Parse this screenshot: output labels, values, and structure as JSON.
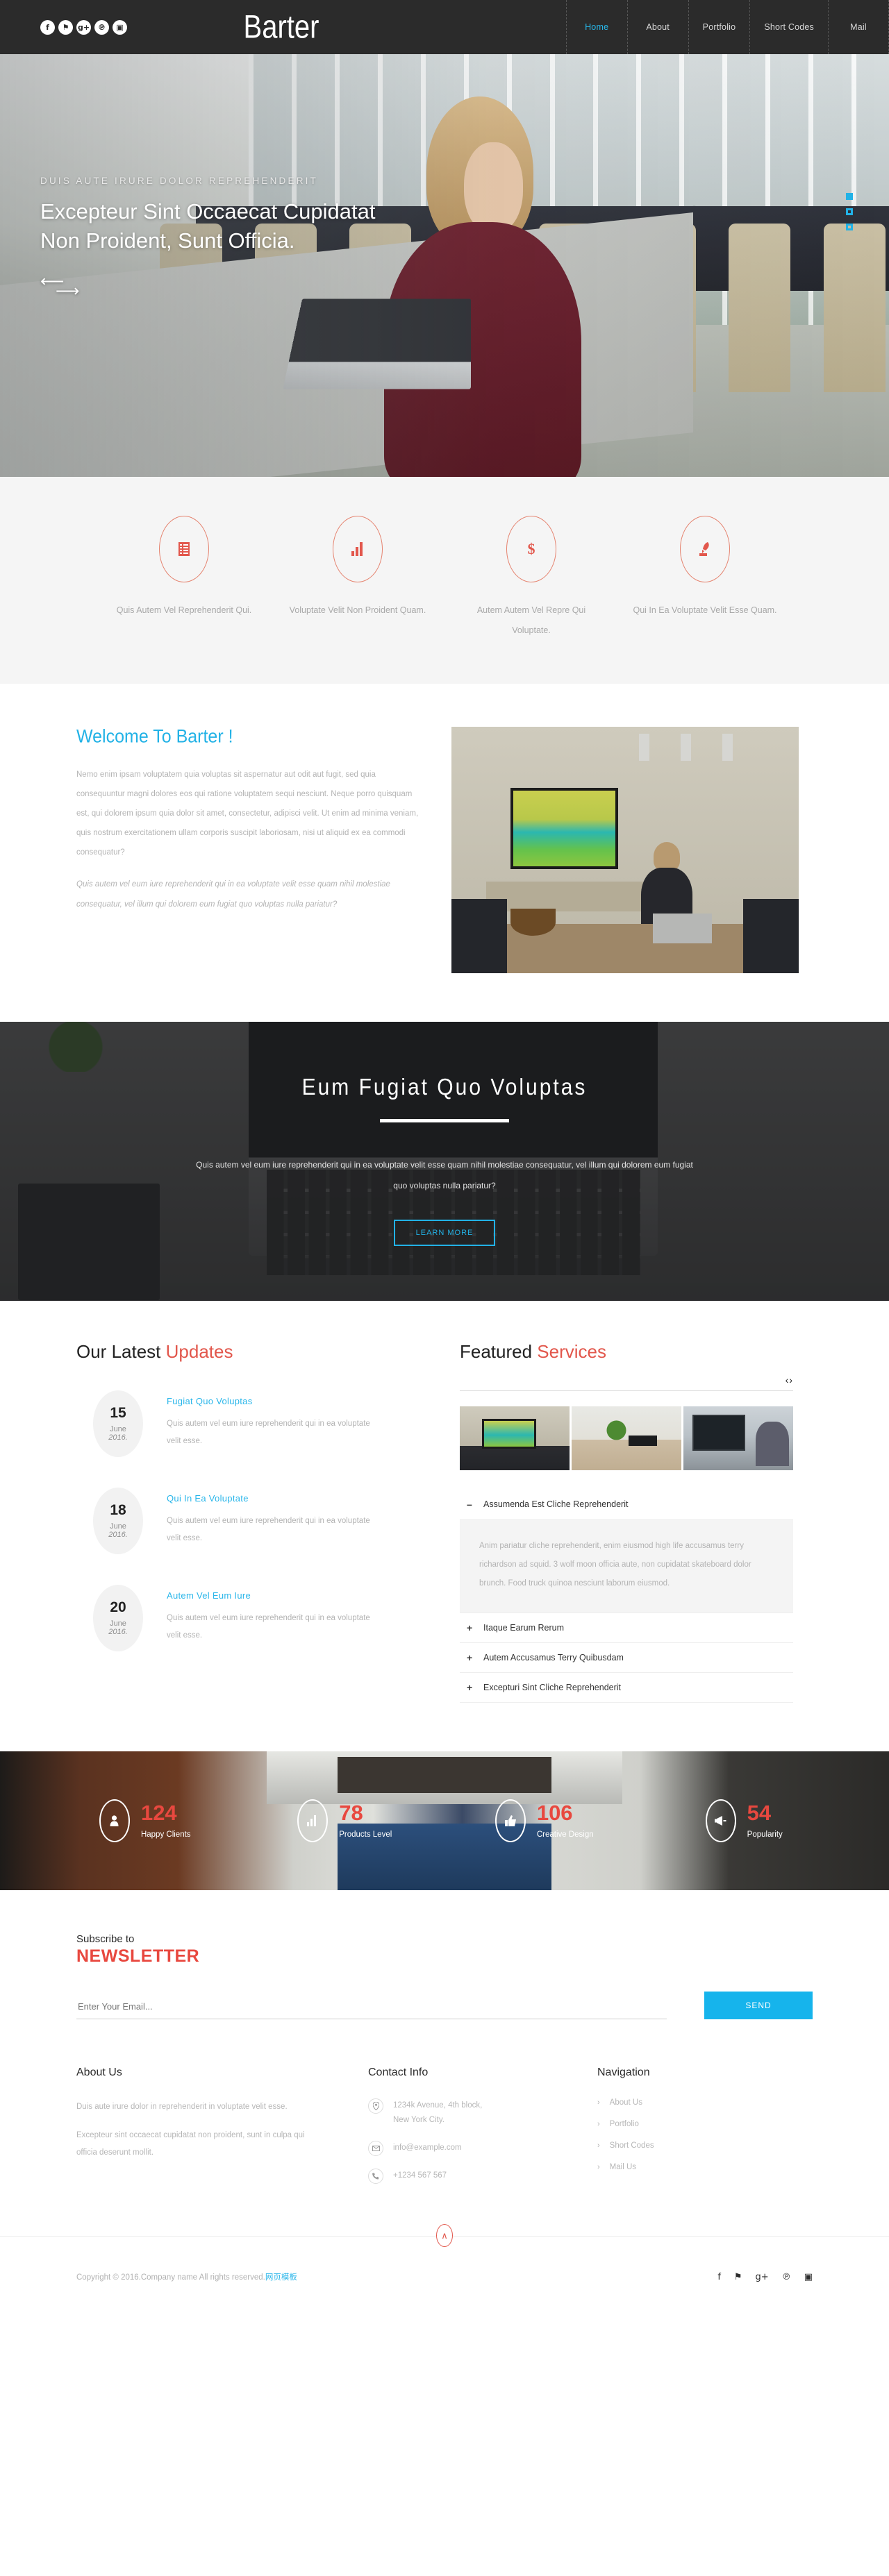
{
  "header": {
    "brand": "Barter",
    "social": [
      {
        "name": "facebook-icon",
        "glyph": "f"
      },
      {
        "name": "twitter-icon",
        "glyph": "⚑"
      },
      {
        "name": "googleplus-icon",
        "glyph": "g+"
      },
      {
        "name": "pinterest-icon",
        "glyph": "℗"
      },
      {
        "name": "instagram-icon",
        "glyph": "▣"
      }
    ],
    "nav": [
      {
        "label": "Home",
        "active": true
      },
      {
        "label": "About",
        "active": false
      },
      {
        "label": "Portfolio",
        "active": false
      },
      {
        "label": "Short Codes",
        "active": false
      },
      {
        "label": "Mail",
        "active": false
      }
    ],
    "accent_active": "#28b7e8",
    "bg": "#2b2b2b"
  },
  "hero": {
    "kicker": "DUIS AUTE IRURE DOLOR REPREHENDERIT",
    "title_line1": "Excepteur Sint Occaecat Cupidatat",
    "title_line2": "Non Proident, Sunt Officia.",
    "prev_arrow": "⟵",
    "next_arrow": "⟶",
    "dots": [
      true,
      false,
      false
    ],
    "dot_color": "#22b2e6"
  },
  "services_icons": {
    "items": [
      {
        "icon": "list-document-icon",
        "text": "Quis Autem Vel Reprehenderit Qui."
      },
      {
        "icon": "bar-chart-icon",
        "text": "Voluptate Velit Non Proident Quam."
      },
      {
        "icon": "dollar-icon",
        "text": "Autem Autem Vel Repre Qui Voluptate."
      },
      {
        "icon": "rocket-icon",
        "text": "Qui In Ea Voluptate Velit Esse Quam."
      }
    ],
    "accent": "#e2574c"
  },
  "welcome": {
    "heading": "Welcome To Barter !",
    "paragraph": "Nemo enim ipsam voluptatem quia voluptas sit aspernatur aut odit aut fugit, sed quia consequuntur magni dolores eos qui ratione voluptatem sequi nesciunt. Neque porro quisquam est, qui dolorem ipsum quia dolor sit amet, consectetur, adipisci velit. Ut enim ad minima veniam, quis nostrum exercitationem ullam corporis suscipit laboriosam, nisi ut aliquid ex ea commodi consequatur?",
    "quote": "Quis autem vel eum iure reprehenderit qui in ea voluptate velit esse quam nihil molestiae consequatur, vel illum qui dolorem eum fugiat quo voluptas nulla pariatur?",
    "accent": "#22b2e6"
  },
  "parallax": {
    "title": "Eum Fugiat Quo Voluptas",
    "paragraph": "Quis autem vel eum iure reprehenderit qui in ea voluptate velit esse quam nihil molestiae consequatur, vel illum qui dolorem eum fugiat quo voluptas nulla pariatur?",
    "button": "LEARN MORE",
    "button_color": "#22b2e6"
  },
  "updates": {
    "heading_plain": "Our Latest ",
    "heading_accent": "Updates",
    "items": [
      {
        "day": "15",
        "month": "June",
        "year": "2016.",
        "title": "Fugiat Quo Voluptas",
        "text": "Quis autem vel eum iure reprehenderit qui in ea voluptate velit esse."
      },
      {
        "day": "18",
        "month": "June",
        "year": "2016.",
        "title": "Qui In Ea Voluptate",
        "text": "Quis autem vel eum iure reprehenderit qui in ea voluptate velit esse."
      },
      {
        "day": "20",
        "month": "June",
        "year": "2016.",
        "title": "Autem Vel Eum Iure",
        "text": "Quis autem vel eum iure reprehenderit qui in ea voluptate velit esse."
      }
    ]
  },
  "featured": {
    "heading_plain": "Featured ",
    "heading_accent": "Services",
    "prev": "‹",
    "next": "›",
    "accordion": [
      {
        "sign": "–",
        "title": "Assumenda Est Cliche Reprehenderit",
        "open": true,
        "body": "Anim pariatur cliche reprehenderit, enim eiusmod high life accusamus terry richardson ad squid. 3 wolf moon officia aute, non cupidatat skateboard dolor brunch. Food truck quinoa nesciunt laborum eiusmod."
      },
      {
        "sign": "+",
        "title": "Itaque Earum Rerum",
        "open": false,
        "body": ""
      },
      {
        "sign": "+",
        "title": "Autem Accusamus Terry Quibusdam",
        "open": false,
        "body": ""
      },
      {
        "sign": "+",
        "title": "Excepturi Sint Cliche Reprehenderit",
        "open": false,
        "body": ""
      }
    ]
  },
  "counters": {
    "items": [
      {
        "icon": "user-icon",
        "value": "124",
        "label": "Happy Clients"
      },
      {
        "icon": "bar-chart-icon",
        "value": "78",
        "label": "Products Level"
      },
      {
        "icon": "thumbs-up-icon",
        "value": "106",
        "label": "Creative Design"
      },
      {
        "icon": "megaphone-icon",
        "value": "54",
        "label": "Popularity"
      }
    ],
    "number_color": "#e8483f"
  },
  "newsletter": {
    "subtitle": "Subscribe to",
    "title": "NEWSLETTER",
    "placeholder": "Enter Your Email...",
    "value": "",
    "button": "SEND",
    "button_color": "#16b4ec"
  },
  "footer": {
    "about": {
      "heading": "About Us",
      "p1": "Duis aute irure dolor in reprehenderit in voluptate velit esse.",
      "p2": "Excepteur sint occaecat cupidatat non proident, sunt in culpa qui officia deserunt mollit."
    },
    "contact": {
      "heading": "Contact Info",
      "rows": [
        {
          "icon": "location-pin-icon",
          "glyph": "◉",
          "text": "1234k Avenue, 4th block,\nNew York City."
        },
        {
          "icon": "envelope-icon",
          "glyph": "✉",
          "text": "info@example.com"
        },
        {
          "icon": "phone-icon",
          "glyph": "☎",
          "text": "+1234 567 567"
        }
      ]
    },
    "navigation": {
      "heading": "Navigation",
      "items": [
        "About Us",
        "Portfolio",
        "Short Codes",
        "Mail Us"
      ],
      "chevron": "›"
    },
    "to_top": "∧",
    "copyright_text": "Copyright © 2016.Company name All rights reserved.",
    "copyright_link": "网页模板",
    "social": [
      {
        "name": "facebook-icon",
        "glyph": "f"
      },
      {
        "name": "twitter-icon",
        "glyph": "⚑"
      },
      {
        "name": "googleplus-icon",
        "glyph": "g+"
      },
      {
        "name": "pinterest-icon",
        "glyph": "℗"
      },
      {
        "name": "instagram-icon",
        "glyph": "▣"
      }
    ]
  }
}
